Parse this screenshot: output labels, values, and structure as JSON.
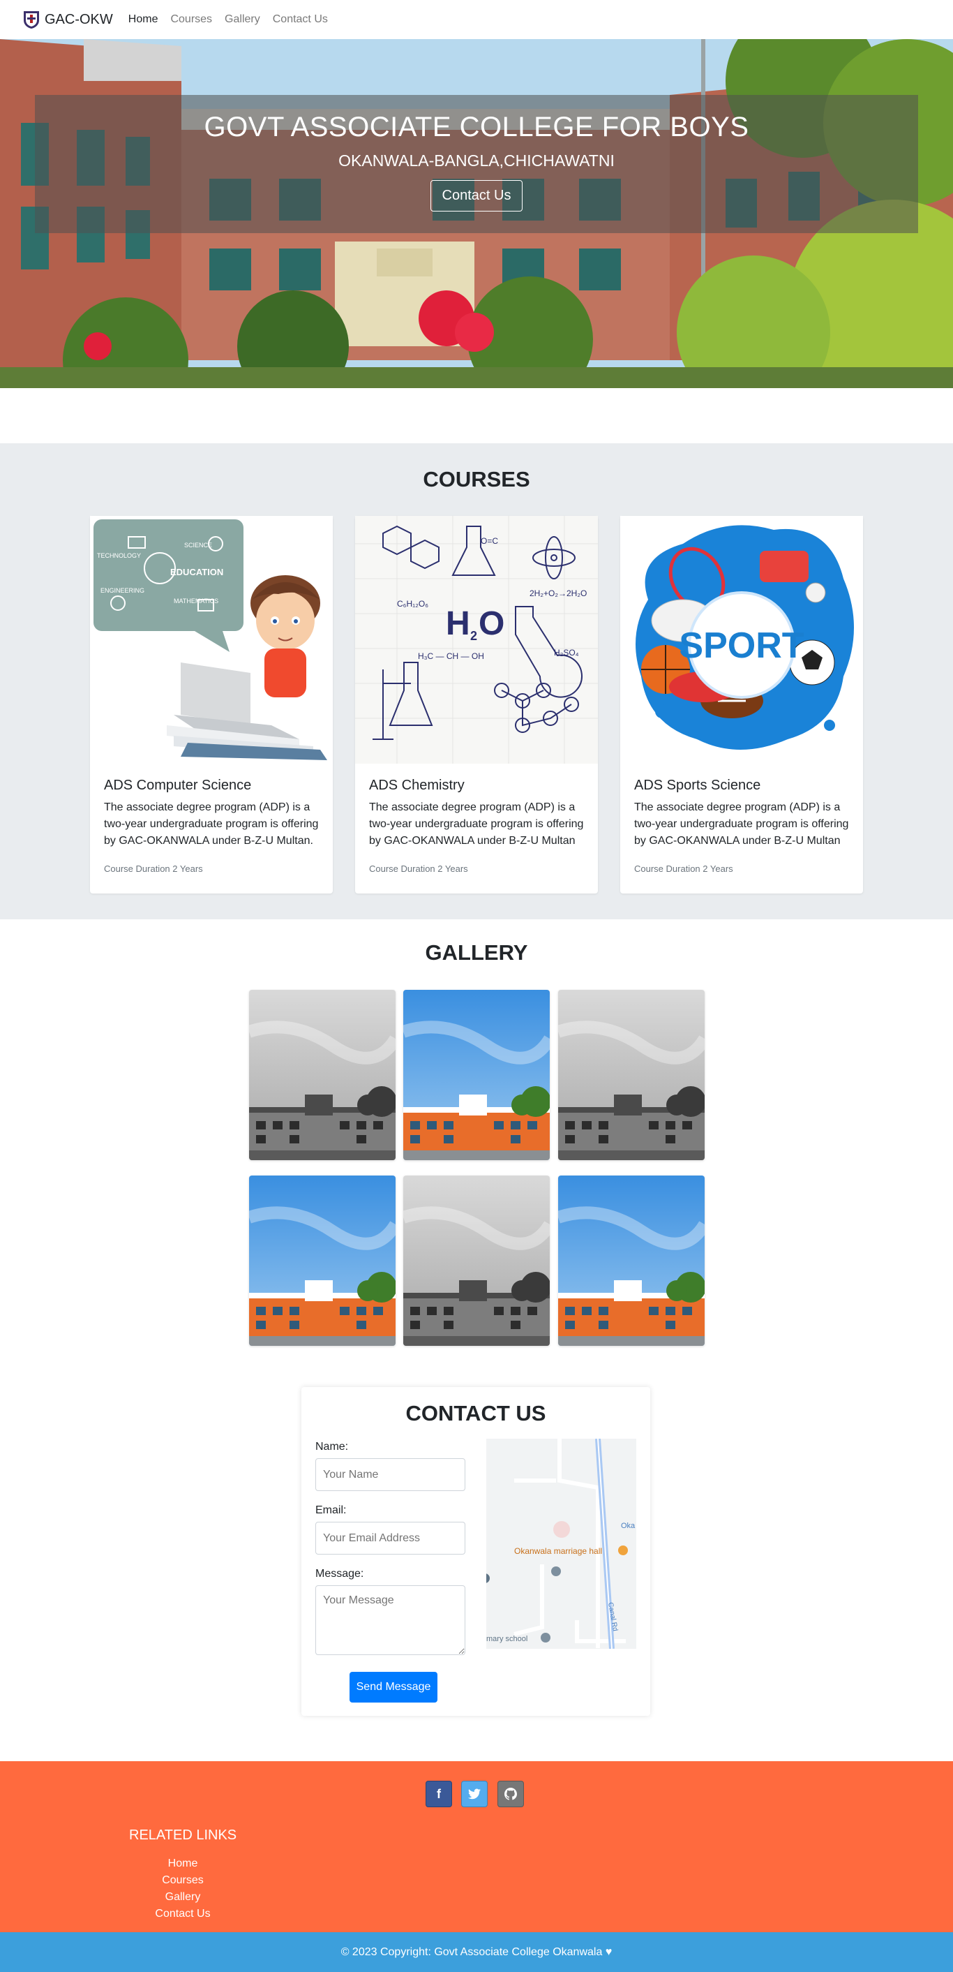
{
  "nav": {
    "brand": "GAC-OKW",
    "links": [
      "Home",
      "Courses",
      "Gallery",
      "Contact Us"
    ]
  },
  "hero": {
    "title": "GOVT ASSOCIATE COLLEGE FOR BOYS",
    "subtitle": "OKANWALA-BANGLA,CHICHAWATNI",
    "button": "Contact Us"
  },
  "courses": {
    "title": "COURSES",
    "items": [
      {
        "title": "ADS Computer Science",
        "text": "The associate degree program (ADP) is a two-year undergraduate program is offering by GAC-OKANWALA under B-Z-U Multan.",
        "duration": "Course Duration 2 Years",
        "image": "stem-education-illustration"
      },
      {
        "title": "ADS Chemistry",
        "text": "The associate degree program (ADP) is a two-year undergraduate program is offering by GAC-OKANWALA under B-Z-U Multan",
        "duration": "Course Duration 2 Years",
        "image": "chemistry-doodle-illustration"
      },
      {
        "title": "ADS Sports Science",
        "text": "The associate degree program (ADP) is a two-year undergraduate program is offering by GAC-OKANWALA under B-Z-U Multan",
        "duration": "Course Duration 2 Years",
        "image": "sport-equipment-illustration",
        "badge": "SPORT"
      }
    ]
  },
  "gallery": {
    "title": "GALLERY",
    "images": [
      "grayscale",
      "color",
      "grayscale",
      "color",
      "grayscale",
      "color"
    ]
  },
  "contact": {
    "title": "CONTACT US",
    "name_label": "Name:",
    "name_placeholder": "Your Name",
    "email_label": "Email:",
    "email_placeholder": "Your Email Address",
    "message_label": "Message:",
    "message_placeholder": "Your Message",
    "send": "Send Message",
    "map": {
      "place": "Okanwala marriage hall",
      "edge_label": "Oka",
      "road": "Canal Rd",
      "school": "mary school"
    }
  },
  "footer": {
    "social": [
      "facebook-icon",
      "twitter-icon",
      "github-icon"
    ],
    "related_title": "RELATED LINKS",
    "links": [
      "Home",
      "Courses",
      "Gallery",
      "Contact Us"
    ],
    "copyright": "© 2023 Copyright: Govt Associate College Okanwala ♥"
  },
  "colors": {
    "footer": "#ff6a3e",
    "copyright_bar": "#3c9fdc",
    "primary_button": "#007bff",
    "courses_bg": "#e9ecef"
  }
}
